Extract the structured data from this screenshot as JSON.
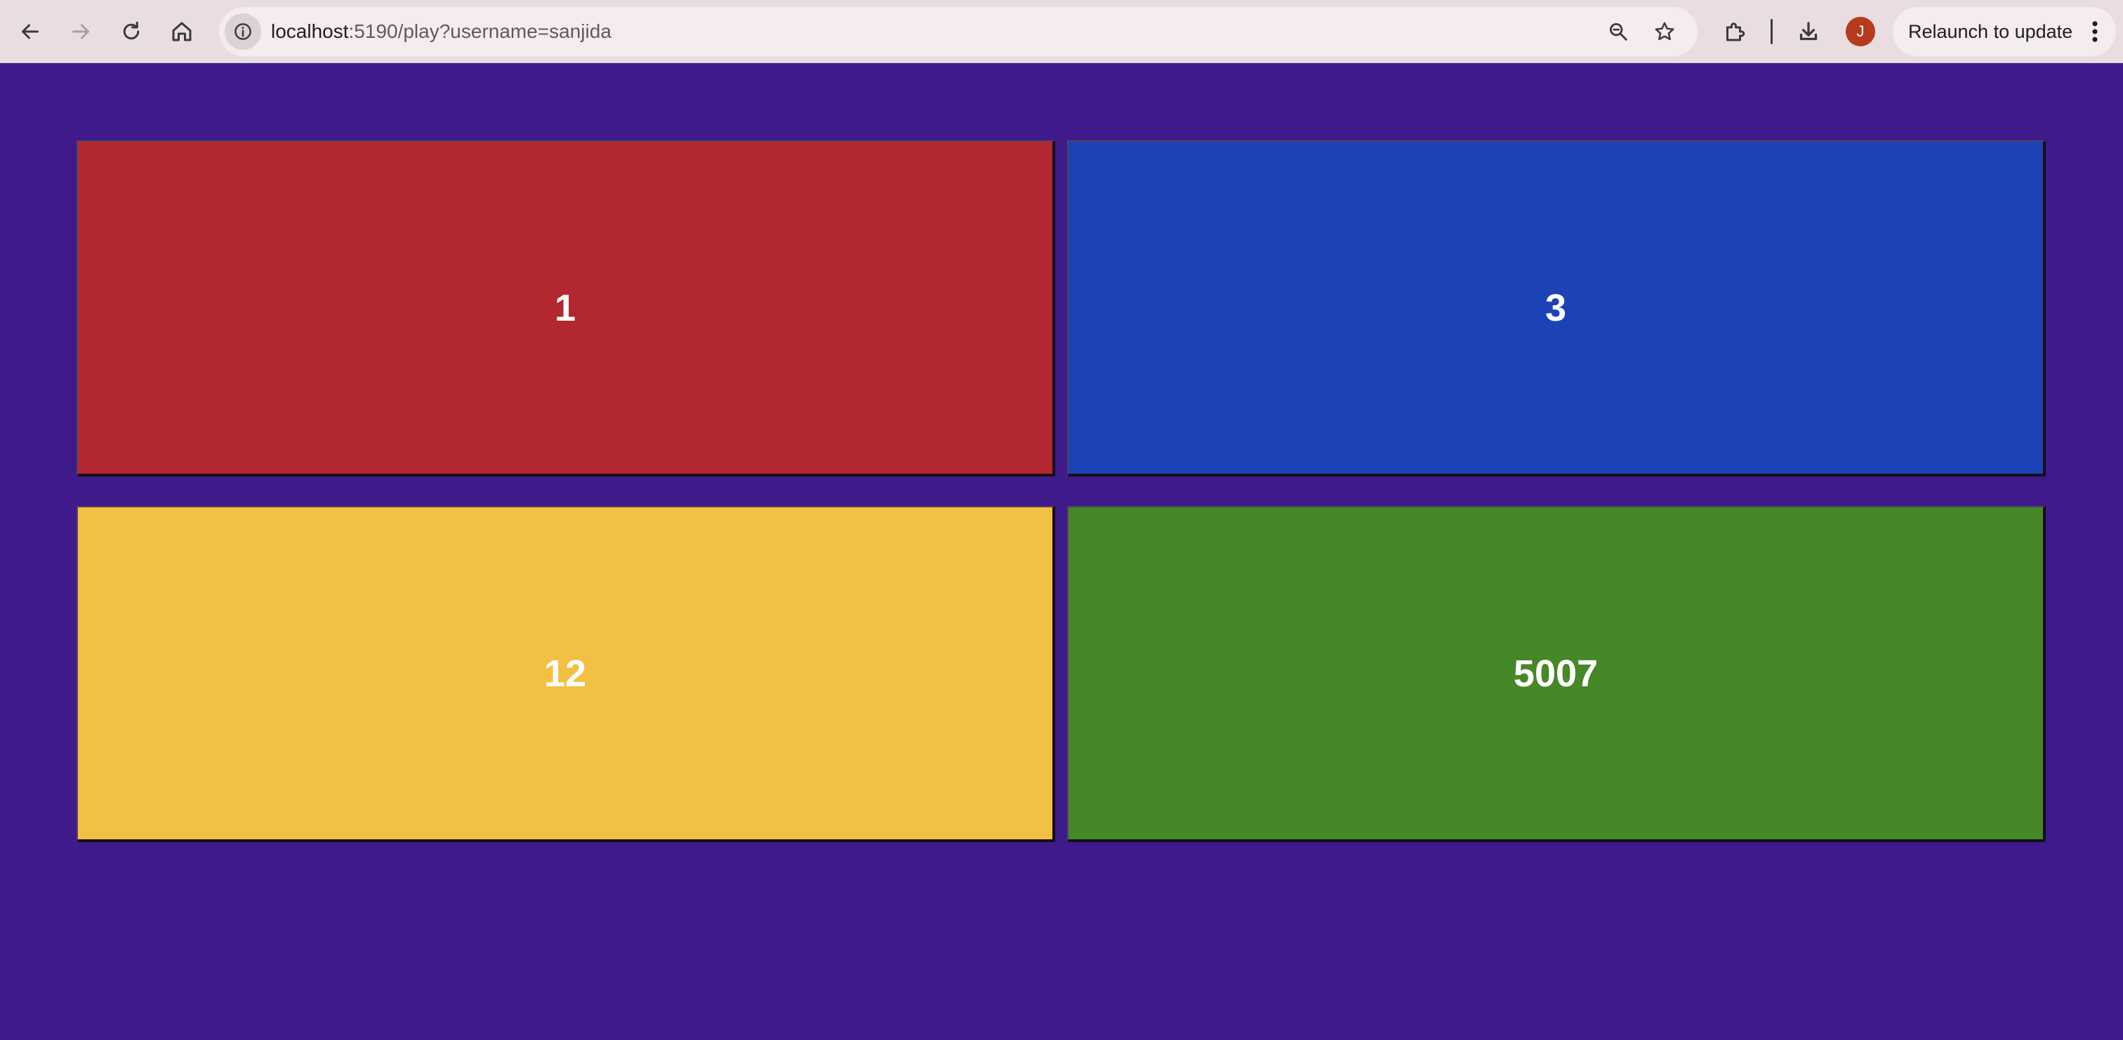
{
  "browser": {
    "url_host": "localhost",
    "url_rest": ":5190/play?username=sanjida",
    "profile_initial": "J",
    "relaunch_label": "Relaunch to update",
    "icons": {
      "back": "arrow-left-icon",
      "forward": "arrow-right-icon",
      "reload": "reload-icon",
      "home": "home-icon",
      "site_info": "info-icon",
      "zoom": "zoom-icon",
      "bookmark": "star-icon",
      "extensions": "puzzle-icon",
      "downloads": "download-icon",
      "menu": "kebab-menu-icon"
    },
    "colors": {
      "toolbar": "#e9dde1",
      "avatar": "#b63a1c"
    }
  },
  "page": {
    "background": "#3f1a8a",
    "tiles": [
      {
        "label": "1",
        "color": "#b32730"
      },
      {
        "label": "3",
        "color": "#1c42b5"
      },
      {
        "label": "12",
        "color": "#f2c144"
      },
      {
        "label": "5007",
        "color": "#468728"
      }
    ]
  }
}
